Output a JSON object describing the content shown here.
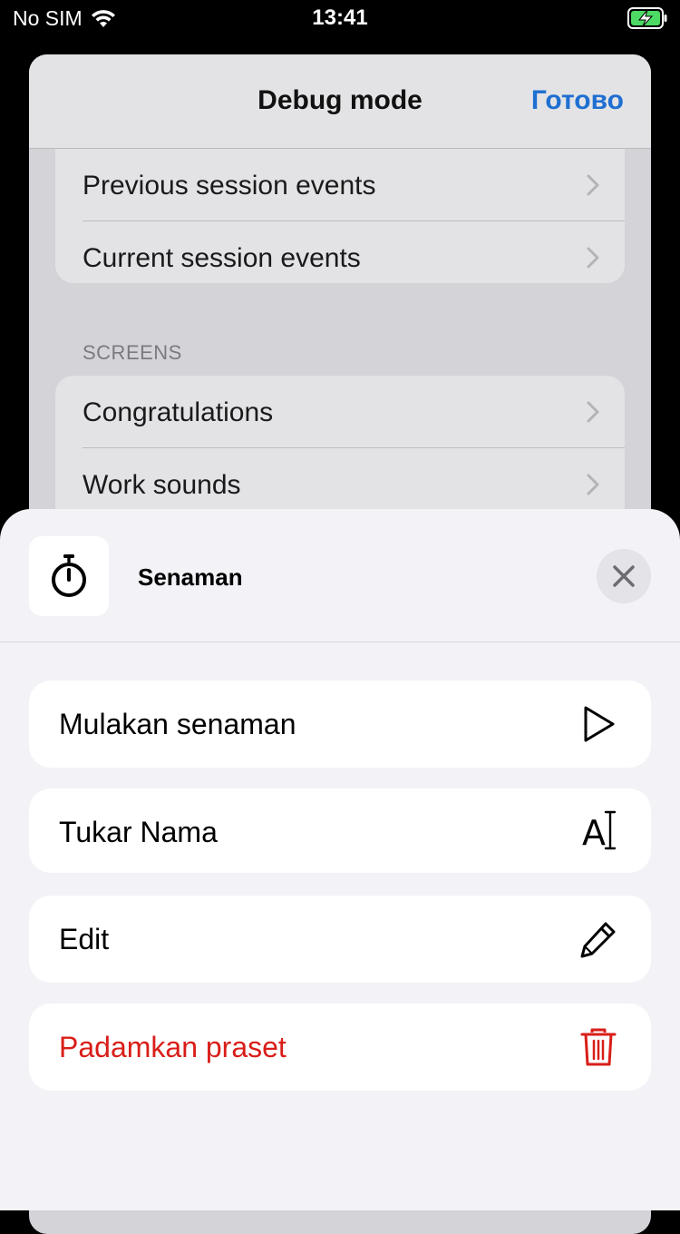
{
  "status_bar": {
    "carrier": "No SIM",
    "time": "13:41"
  },
  "background_screen": {
    "title": "Debug mode",
    "done_label": "Готово",
    "group1_rows": [
      {
        "label": "Previous session events"
      },
      {
        "label": "Current session events"
      }
    ],
    "section_header": "SCREENS",
    "group2_rows": [
      {
        "label": "Congratulations"
      },
      {
        "label": "Work sounds"
      }
    ]
  },
  "sheet": {
    "title": "Senaman",
    "header_icon": "stopwatch-icon",
    "actions": [
      {
        "label": "Mulakan senaman",
        "icon": "play-icon"
      },
      {
        "label": "Tukar Nama",
        "icon": "text-cursor-icon",
        "icon_text": "A"
      },
      {
        "label": "Edit",
        "icon": "pencil-icon"
      },
      {
        "label": "Padamkan praset",
        "icon": "trash-icon",
        "destructive": true
      }
    ]
  },
  "colors": {
    "accent": "#1f6fd1",
    "destructive": "#d91e18",
    "sheet_background": "#f2f2f7"
  }
}
